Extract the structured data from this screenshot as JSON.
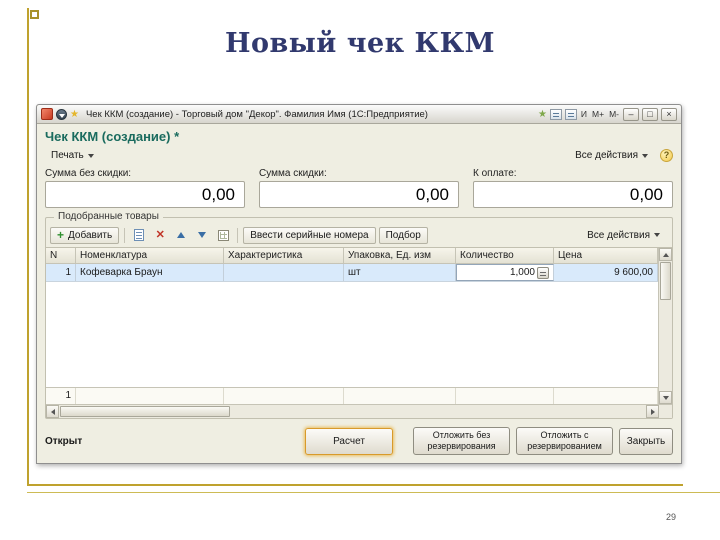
{
  "slide": {
    "title": "Новый чек ККМ",
    "page_number": "29"
  },
  "palette": {
    "accent_gold": "#BFA22E",
    "title_blue": "#31396E",
    "form_header_teal": "#1A6B5E",
    "selection_blue": "#D9EAFB",
    "form_background": "#EFEEE2"
  },
  "window": {
    "titlebar": {
      "title": "Чек ККМ (создание) - Торговый дом \"Декор\". Фамилия Имя (1С:Предприятие)",
      "favorites_star": "★",
      "mem_indicator": "И",
      "mem_plus": "М+",
      "mem_minus": "М-",
      "minimize": "–",
      "maximize": "□",
      "close": "×"
    },
    "form": {
      "header": "Чек ККМ (создание) *",
      "print_menu": "Печать",
      "all_actions_top": "Все действия",
      "help": "?"
    },
    "totals": [
      {
        "label": "Сумма без скидки:",
        "value": "0,00"
      },
      {
        "label": "Сумма скидки:",
        "value": "0,00"
      },
      {
        "label": "К оплате:",
        "value": "0,00"
      }
    ],
    "items_group": {
      "title": "Подобранные товары",
      "toolbar": {
        "add": "Добавить",
        "enter_serials": "Ввести серийные номера",
        "pick": "Подбор",
        "all_actions": "Все действия"
      },
      "table": {
        "columns": [
          "N",
          "Номенклатура",
          "Характеристика",
          "Упаковка, Ед. изм",
          "Количество",
          "Цена"
        ],
        "rows": [
          {
            "n": "1",
            "nomenclature": "Кофеварка Браун",
            "characteristic": "",
            "unit": "шт",
            "quantity": "1,000",
            "price": "9 600,00"
          }
        ],
        "footer_n": "1"
      }
    },
    "footer": {
      "status": "Открыт",
      "buttons": {
        "calc": "Расчет",
        "hold_without": "Отложить без резервирования",
        "hold_with": "Отложить с резервированием",
        "close": "Закрыть"
      }
    }
  }
}
